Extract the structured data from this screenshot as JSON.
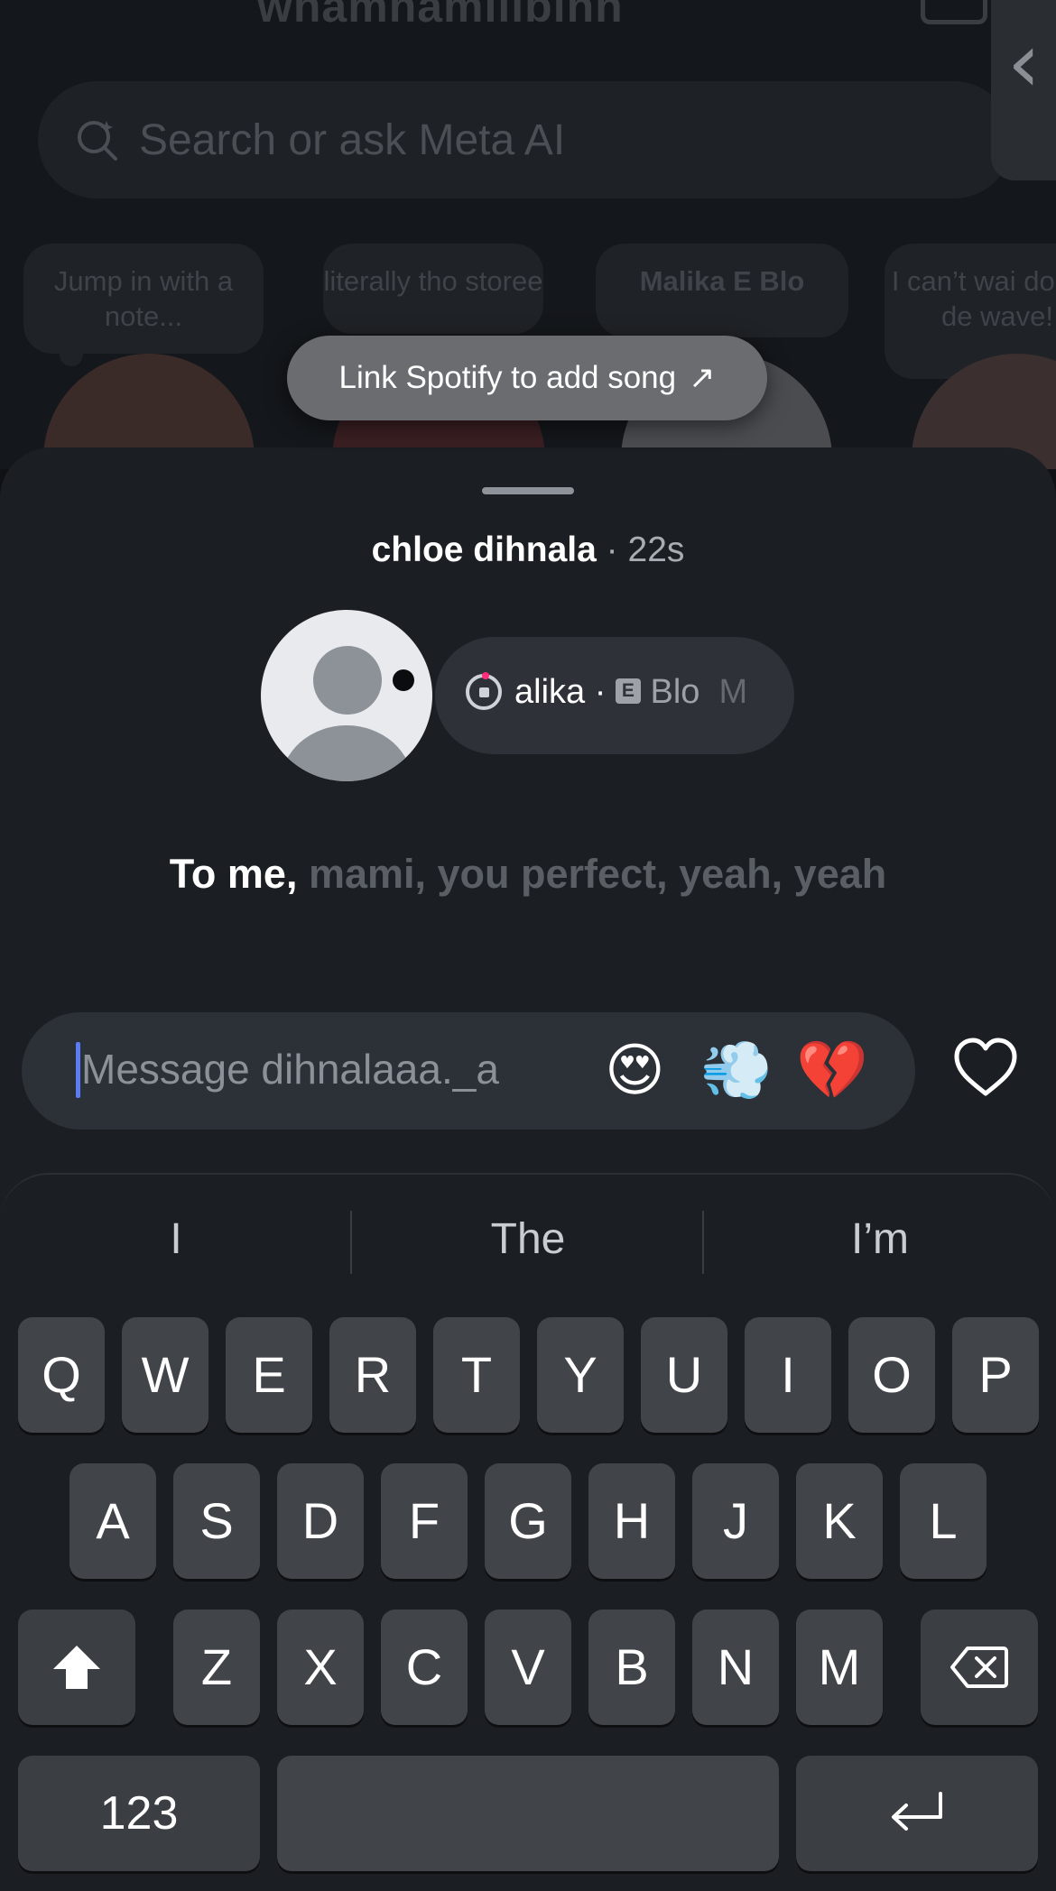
{
  "background": {
    "title": "whamhamilibinn",
    "search_placeholder": "Search or ask Meta AI",
    "notes": [
      {
        "text": "Jump in with a note..."
      },
      {
        "text": "literally tho storee"
      },
      {
        "text": "Malika E Blo"
      },
      {
        "text": "I can’t wai do red de wave!"
      }
    ]
  },
  "toast": {
    "label": "Link Spotify to add song",
    "arrow": "↗"
  },
  "sheet": {
    "user": "chloe dihnala",
    "separator": " · ",
    "time": "22s",
    "music": {
      "prefix": "alika · ",
      "badge": "E",
      "suffix": " Blo",
      "trail": "M"
    },
    "lyric": {
      "lead": "To me,",
      "rest": "mami, you perfect, yeah, yeah"
    },
    "reply": {
      "placeholder": "Message dihnalaaa._a",
      "quick_reactions": [
        "😍",
        "💨",
        "💔"
      ]
    }
  },
  "keyboard": {
    "suggestions": [
      "I",
      "The",
      "I’m"
    ],
    "row1": [
      "Q",
      "W",
      "E",
      "R",
      "T",
      "Y",
      "U",
      "I",
      "O",
      "P"
    ],
    "row2": [
      "A",
      "S",
      "D",
      "F",
      "G",
      "H",
      "J",
      "K",
      "L"
    ],
    "row3": [
      "Z",
      "X",
      "C",
      "V",
      "B",
      "N",
      "M"
    ],
    "numbers_label": "123"
  },
  "colors": {
    "caret": "#5b7cf5",
    "sheet": "#1b1e22",
    "key": "#414448"
  }
}
